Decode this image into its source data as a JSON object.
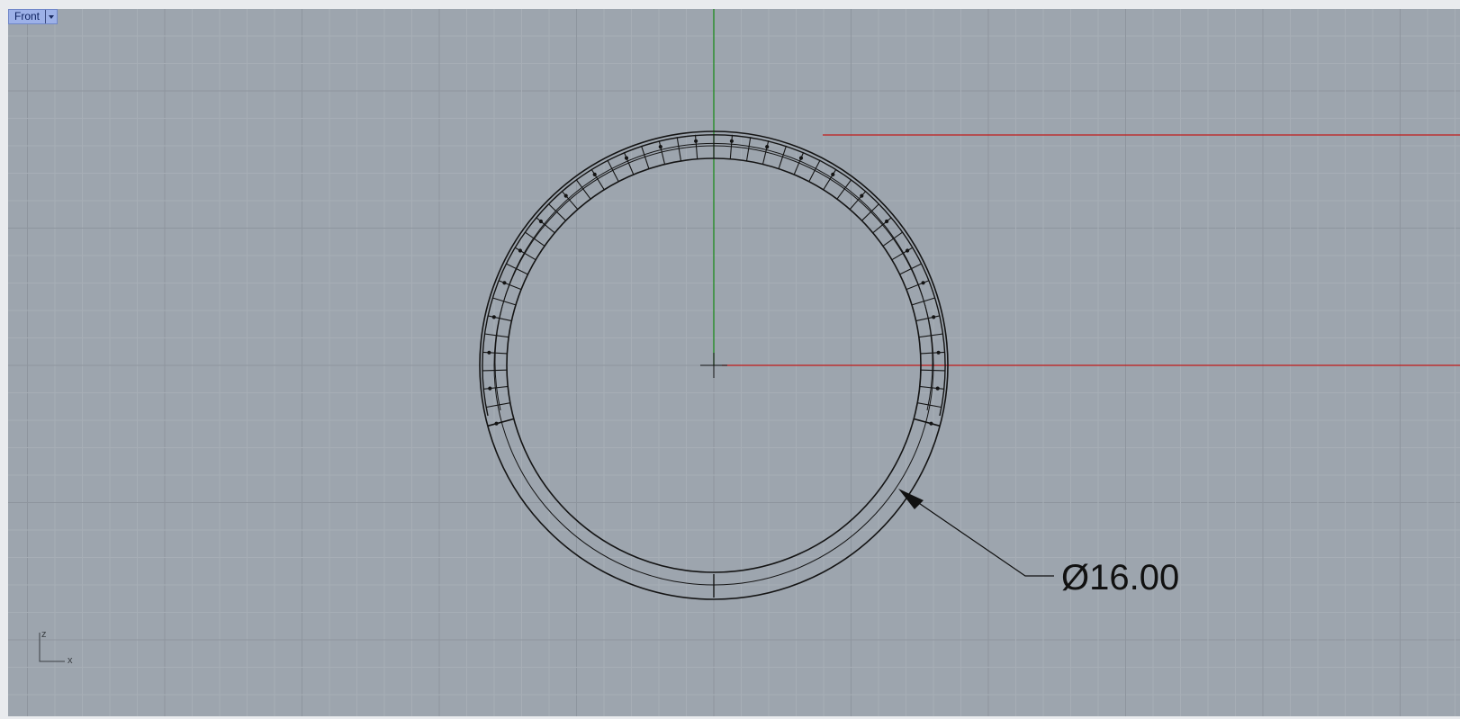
{
  "viewport": {
    "name": "Front",
    "dimension_label": "Ø16.00",
    "axis_icon": {
      "vertical": "z",
      "horizontal": "x"
    }
  },
  "colors": {
    "background": "#9da5ae",
    "grid_minor": "#a7aeb6",
    "grid_major": "#8e959e",
    "x_axis": "#c21a1a",
    "z_axis": "#1f8a1f",
    "geometry": "#141414"
  },
  "icons": [
    "dropdown-arrow-icon",
    "axis-icon",
    "origin-crosshair-icon"
  ]
}
